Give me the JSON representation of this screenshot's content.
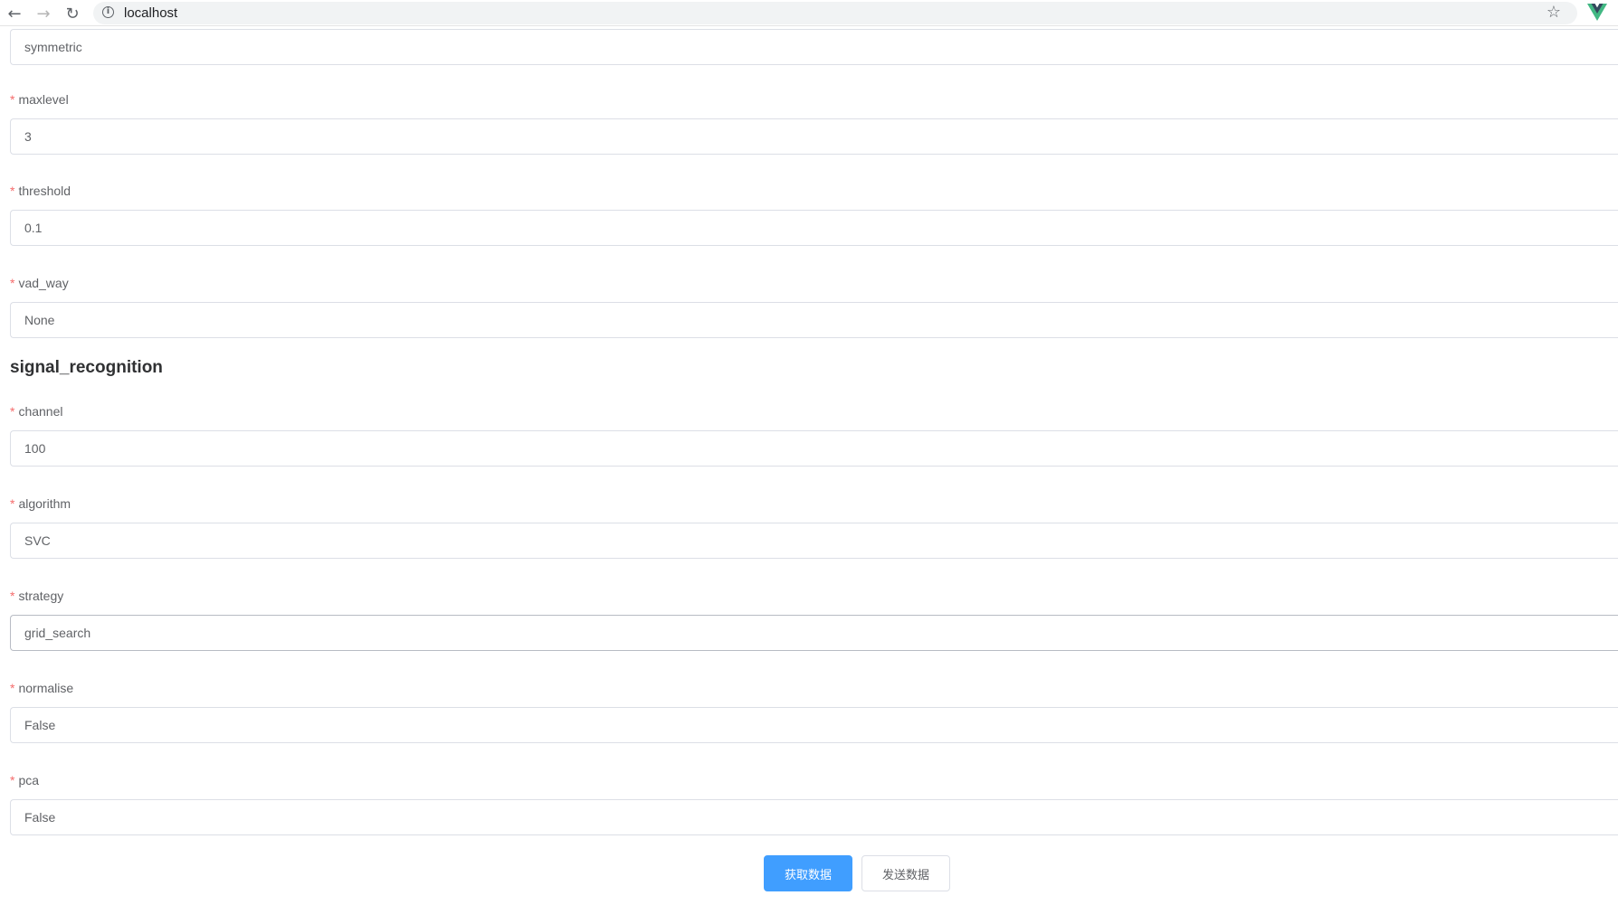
{
  "browser": {
    "url": "localhost",
    "icons": {
      "back": "arrow-left-icon",
      "forward": "arrow-right-icon",
      "reload": "reload-icon",
      "info": "info-icon",
      "bookmark": "star-icon",
      "extension": "vue-devtools-icon"
    }
  },
  "form": {
    "required_mark": "*",
    "fields_top": [
      {
        "value": "symmetric"
      },
      {
        "label": "maxlevel",
        "value": "3"
      },
      {
        "label": "threshold",
        "value": "0.1"
      },
      {
        "label": "vad_way",
        "value": "None"
      }
    ],
    "section_title": "signal_recognition",
    "fields_section": [
      {
        "label": "channel",
        "value": "100"
      },
      {
        "label": "algorithm",
        "value": "SVC"
      },
      {
        "label": "strategy",
        "value": "grid_search"
      },
      {
        "label": "normalise",
        "value": "False"
      },
      {
        "label": "pca",
        "value": "False"
      }
    ]
  },
  "actions": {
    "fetch_label": "获取数据",
    "send_label": "发送数据"
  },
  "colors": {
    "primary": "#409eff",
    "required": "#f56c6c",
    "vue_green": "#42b883"
  }
}
